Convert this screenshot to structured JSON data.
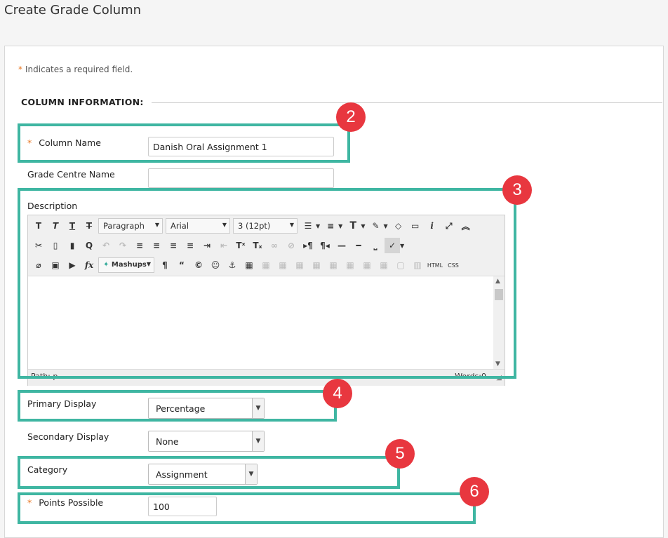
{
  "page": {
    "title": "Create Grade Column"
  },
  "form": {
    "required_note": "Indicates a required field.",
    "required_mark": "*",
    "section_title": "COLUMN INFORMATION:",
    "column_name": {
      "label": "Column Name",
      "value": "Danish Oral Assignment 1"
    },
    "grade_centre_name": {
      "label": "Grade Centre Name",
      "value": ""
    },
    "description": {
      "label": "Description"
    },
    "primary_display": {
      "label": "Primary Display",
      "value": "Percentage"
    },
    "secondary_display": {
      "label": "Secondary Display",
      "value": "None"
    },
    "category": {
      "label": "Category",
      "value": "Assignment"
    },
    "points_possible": {
      "label": "Points Possible",
      "value": "100"
    }
  },
  "editor": {
    "paragraph": "Paragraph",
    "font": "Arial",
    "size": "3 (12pt)",
    "mashups": "Mashups",
    "html_label": "HTML",
    "css_label": "CSS",
    "path": "Path: p",
    "words": "Words:0"
  },
  "annotations": {
    "badge2": "2",
    "badge3": "3",
    "badge4": "4",
    "badge5": "5",
    "badge6": "6"
  },
  "colors": {
    "highlight": "#3fb6a2",
    "badge": "#e8373f",
    "required": "#e87722"
  }
}
